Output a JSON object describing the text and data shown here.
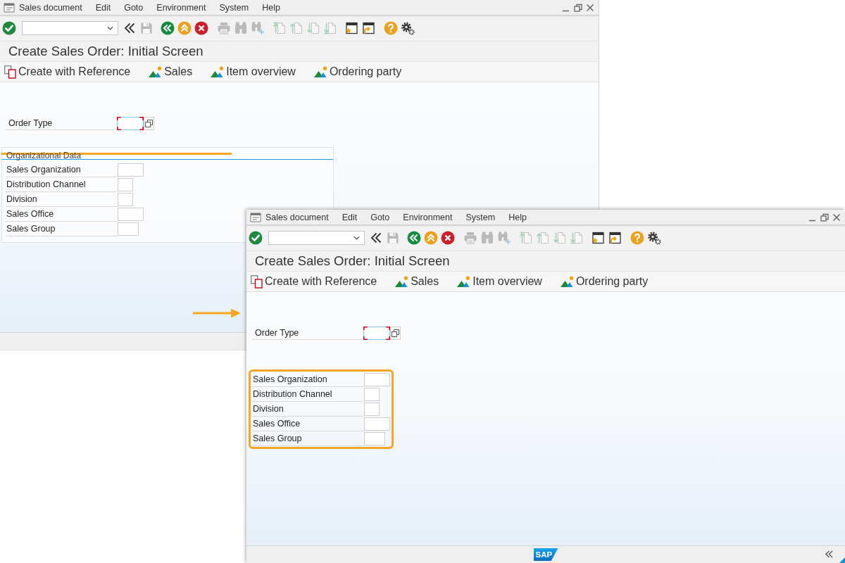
{
  "windows": [
    {
      "menu": [
        "Sales document",
        "Edit",
        "Goto",
        "Environment",
        "System",
        "Help"
      ],
      "toolbar": [
        {
          "disabled": false
        },
        {
          "disabled": false
        },
        {
          "disabled": true
        },
        {
          "disabled": false
        },
        {
          "disabled": false
        },
        {
          "disabled": false
        },
        {
          "disabled": true
        },
        {
          "disabled": true
        },
        {
          "disabled": true
        },
        {
          "disabled": true
        },
        {
          "disabled": true
        },
        {
          "disabled": true
        },
        {
          "disabled": true
        },
        {
          "disabled": false
        },
        {
          "disabled": false
        },
        {
          "disabled": false
        },
        {
          "disabled": false
        }
      ],
      "title": "Create Sales Order: Initial Screen",
      "app_toolbar": [
        {
          "kind": "reference",
          "label": "Create with Reference"
        },
        {
          "kind": "screen",
          "label": "Sales"
        },
        {
          "kind": "screen",
          "label": "Item overview"
        },
        {
          "kind": "screen",
          "label": "Ordering party"
        }
      ],
      "order_type": {
        "label": "Order Type",
        "required": true,
        "focused": true
      },
      "org_data": {
        "title": "Organizational Data",
        "struck_out": true,
        "highlighted": false,
        "fields": [
          "Sales Organization",
          "Distribution Channel",
          "Division",
          "Sales Office",
          "Sales Group"
        ]
      }
    },
    {
      "menu": [
        "Sales document",
        "Edit",
        "Goto",
        "Environment",
        "System",
        "Help"
      ],
      "toolbar": [
        {
          "disabled": false
        },
        {
          "disabled": false
        },
        {
          "disabled": true
        },
        {
          "disabled": false
        },
        {
          "disabled": false
        },
        {
          "disabled": false
        },
        {
          "disabled": true
        },
        {
          "disabled": true
        },
        {
          "disabled": true
        },
        {
          "disabled": true
        },
        {
          "disabled": true
        },
        {
          "disabled": true
        },
        {
          "disabled": true
        },
        {
          "disabled": false
        },
        {
          "disabled": false
        },
        {
          "disabled": false
        },
        {
          "disabled": false
        }
      ],
      "title": "Create Sales Order: Initial Screen",
      "app_toolbar": [
        {
          "kind": "reference",
          "label": "Create with Reference"
        },
        {
          "kind": "screen",
          "label": "Sales"
        },
        {
          "kind": "screen",
          "label": "Item overview"
        },
        {
          "kind": "screen",
          "label": "Ordering party"
        }
      ],
      "order_type": {
        "label": "Order Type",
        "required": true,
        "focused": true
      },
      "org_data": {
        "highlighted": true,
        "fields": [
          "Sales Organization",
          "Distribution Channel",
          "Division",
          "Sales Office",
          "Sales Group"
        ]
      },
      "status_bar": {
        "logo": "SAP"
      }
    }
  ]
}
